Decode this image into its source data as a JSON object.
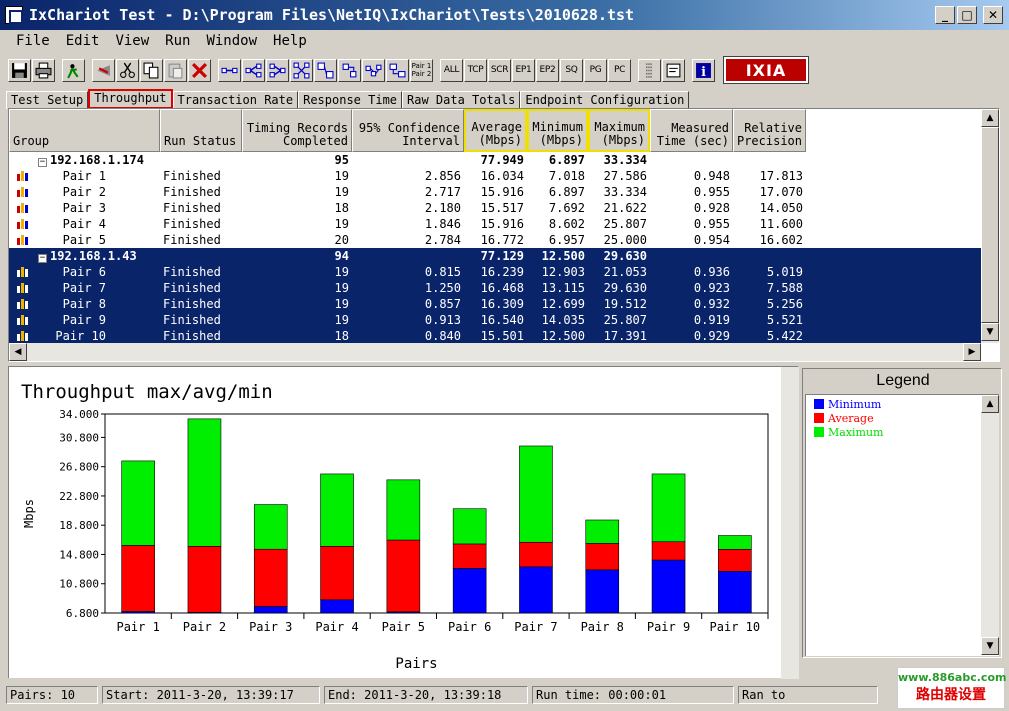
{
  "window": {
    "title": "IxChariot Test - D:\\Program Files\\NetIQ\\IxChariot\\Tests\\2010628.tst"
  },
  "menu": [
    "File",
    "Edit",
    "View",
    "Run",
    "Window",
    "Help"
  ],
  "toolbar": {
    "text_buttons": [
      "ALL",
      "TCP",
      "SCR",
      "EP1",
      "EP2",
      "SQ",
      "PG",
      "PC"
    ],
    "pair_button": "Pair 1\nPair 2",
    "logo": "IXIA"
  },
  "tabs": [
    "Test Setup",
    "Throughput",
    "Transaction Rate",
    "Response Time",
    "Raw Data Totals",
    "Endpoint Configuration"
  ],
  "active_tab": "Throughput",
  "grid": {
    "columns": [
      "Group",
      "Run Status",
      "Timing Records\nCompleted",
      "95% Confidence\nInterval",
      "Average\n(Mbps)",
      "Minimum\n(Mbps)",
      "Maximum\n(Mbps)",
      "Measured\nTime (sec)",
      "Relative\nPrecision"
    ],
    "groups": [
      {
        "name": "192.168.1.174",
        "selected": false,
        "records": "95",
        "avg": "77.949",
        "min": "6.897",
        "max": "33.334",
        "pairs": [
          {
            "name": "Pair 1",
            "status": "Finished",
            "records": "19",
            "ci": "2.856",
            "avg": "16.034",
            "min": "7.018",
            "max": "27.586",
            "time": "0.948",
            "prec": "17.813"
          },
          {
            "name": "Pair 2",
            "status": "Finished",
            "records": "19",
            "ci": "2.717",
            "avg": "15.916",
            "min": "6.897",
            "max": "33.334",
            "time": "0.955",
            "prec": "17.070"
          },
          {
            "name": "Pair 3",
            "status": "Finished",
            "records": "18",
            "ci": "2.180",
            "avg": "15.517",
            "min": "7.692",
            "max": "21.622",
            "time": "0.928",
            "prec": "14.050"
          },
          {
            "name": "Pair 4",
            "status": "Finished",
            "records": "19",
            "ci": "1.846",
            "avg": "15.916",
            "min": "8.602",
            "max": "25.807",
            "time": "0.955",
            "prec": "11.600"
          },
          {
            "name": "Pair 5",
            "status": "Finished",
            "records": "20",
            "ci": "2.784",
            "avg": "16.772",
            "min": "6.957",
            "max": "25.000",
            "time": "0.954",
            "prec": "16.602"
          }
        ]
      },
      {
        "name": "192.168.1.43",
        "selected": true,
        "records": "94",
        "avg": "77.129",
        "min": "12.500",
        "max": "29.630",
        "pairs": [
          {
            "name": "Pair 6",
            "status": "Finished",
            "records": "19",
            "ci": "0.815",
            "avg": "16.239",
            "min": "12.903",
            "max": "21.053",
            "time": "0.936",
            "prec": "5.019"
          },
          {
            "name": "Pair 7",
            "status": "Finished",
            "records": "19",
            "ci": "1.250",
            "avg": "16.468",
            "min": "13.115",
            "max": "29.630",
            "time": "0.923",
            "prec": "7.588"
          },
          {
            "name": "Pair 8",
            "status": "Finished",
            "records": "19",
            "ci": "0.857",
            "avg": "16.309",
            "min": "12.699",
            "max": "19.512",
            "time": "0.932",
            "prec": "5.256"
          },
          {
            "name": "Pair 9",
            "status": "Finished",
            "records": "19",
            "ci": "0.913",
            "avg": "16.540",
            "min": "14.035",
            "max": "25.807",
            "time": "0.919",
            "prec": "5.521"
          },
          {
            "name": "Pair 10",
            "status": "Finished",
            "records": "18",
            "ci": "0.840",
            "avg": "15.501",
            "min": "12.500",
            "max": "17.391",
            "time": "0.929",
            "prec": "5.422"
          }
        ]
      }
    ]
  },
  "chart_data": {
    "type": "bar",
    "stacked": true,
    "title": "Throughput max/avg/min",
    "xlabel": "Pairs",
    "ylabel": "Mbps",
    "categories": [
      "Pair 1",
      "Pair 2",
      "Pair 3",
      "Pair 4",
      "Pair 5",
      "Pair 6",
      "Pair 7",
      "Pair 8",
      "Pair 9",
      "Pair 10"
    ],
    "series": [
      {
        "name": "Minimum",
        "color": "#0000ff",
        "values": [
          7.018,
          6.897,
          7.692,
          8.602,
          6.957,
          12.903,
          13.115,
          12.699,
          14.035,
          12.5
        ]
      },
      {
        "name": "Average",
        "color": "#ff0000",
        "values": [
          16.034,
          15.916,
          15.517,
          15.916,
          16.772,
          16.239,
          16.468,
          16.309,
          16.54,
          15.501
        ]
      },
      {
        "name": "Maximum",
        "color": "#00ee00",
        "values": [
          27.586,
          33.334,
          21.622,
          25.807,
          25.0,
          21.053,
          29.63,
          19.512,
          25.807,
          17.391
        ]
      }
    ],
    "yticks": [
      "6.800",
      "10.800",
      "14.800",
      "18.800",
      "22.800",
      "26.800",
      "30.800",
      "34.000"
    ],
    "ylim": [
      6.8,
      34.0
    ],
    "grid": false
  },
  "legend": {
    "title": "Legend",
    "items": [
      {
        "name": "Minimum",
        "color": "#0000ff"
      },
      {
        "name": "Average",
        "color": "#ff0000"
      },
      {
        "name": "Maximum",
        "color": "#00ee00"
      }
    ]
  },
  "status": {
    "pairs": "Pairs: 10",
    "start": "Start: 2011-3-20, 13:39:17",
    "end": "End: 2011-3-20, 13:39:18",
    "runtime": "Run time: 00:00:01",
    "ran_to": "Ran to"
  },
  "watermark": {
    "url": "www.886abc.com",
    "text": "路由器设置"
  }
}
